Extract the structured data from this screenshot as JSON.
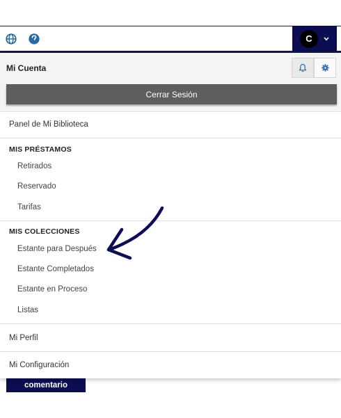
{
  "header": {
    "globe_icon": "globe-icon",
    "help_icon": "question-circle-icon",
    "avatar_letter": "C",
    "account_chevron_icon": "chevron-down-icon"
  },
  "panel": {
    "title": "Mi Cuenta",
    "bell_icon": "bell-icon",
    "gear_icon": "gear-icon",
    "logout_label": "Cerrar Sesión"
  },
  "menu": {
    "dashboard": "Panel de Mi Biblioteca",
    "loans_heading": "MIS PRÉSTAMOS",
    "loans_items": [
      "Retirados",
      "Reservado",
      "Tarifas"
    ],
    "collections_heading": "MIS COLECCIONES",
    "collections_items": [
      "Estante para Después",
      "Estante Completados",
      "Estante en Proceso",
      "Listas"
    ],
    "profile": "Mi Perfil",
    "settings": "Mi Configuración"
  },
  "behind": {
    "comment_button": "comentario"
  },
  "colors": {
    "navy": "#0d0d52",
    "logout_bg": "#5e5e5e",
    "help_blue": "#2a6aa3"
  }
}
